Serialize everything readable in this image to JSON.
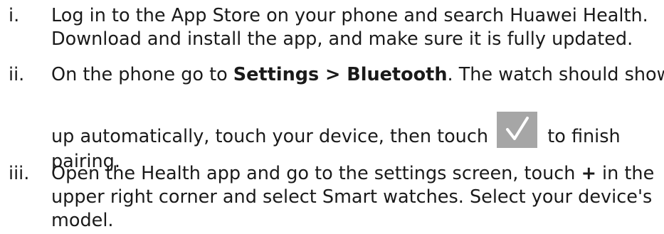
{
  "steps": [
    {
      "number": "i.",
      "lines": [
        "Log in to the App Store on your phone and search Huawei Health.",
        "Download and install the app, and make sure it is fully updated."
      ]
    },
    {
      "number": "ii.",
      "line1_prefix": "On the phone go to ",
      "line1_bold": "Settings > Bluetooth",
      "line1_suffix": ". The watch should show",
      "line2_before_icon": "up automatically, touch your device, then touch ",
      "line2_after_icon": " to finish",
      "line3": "pairing.",
      "icon": "checkmark-icon",
      "icon_colors": {
        "background": "#a6a6a6",
        "check": "#ffffff"
      }
    },
    {
      "number": "iii.",
      "line1_prefix": "Open the Health app and go to the settings screen, touch ",
      "line1_bold": "+",
      "line1_suffix": " in the",
      "line2": "upper right corner and select Smart watches. Select your device's",
      "line3": "model."
    }
  ]
}
